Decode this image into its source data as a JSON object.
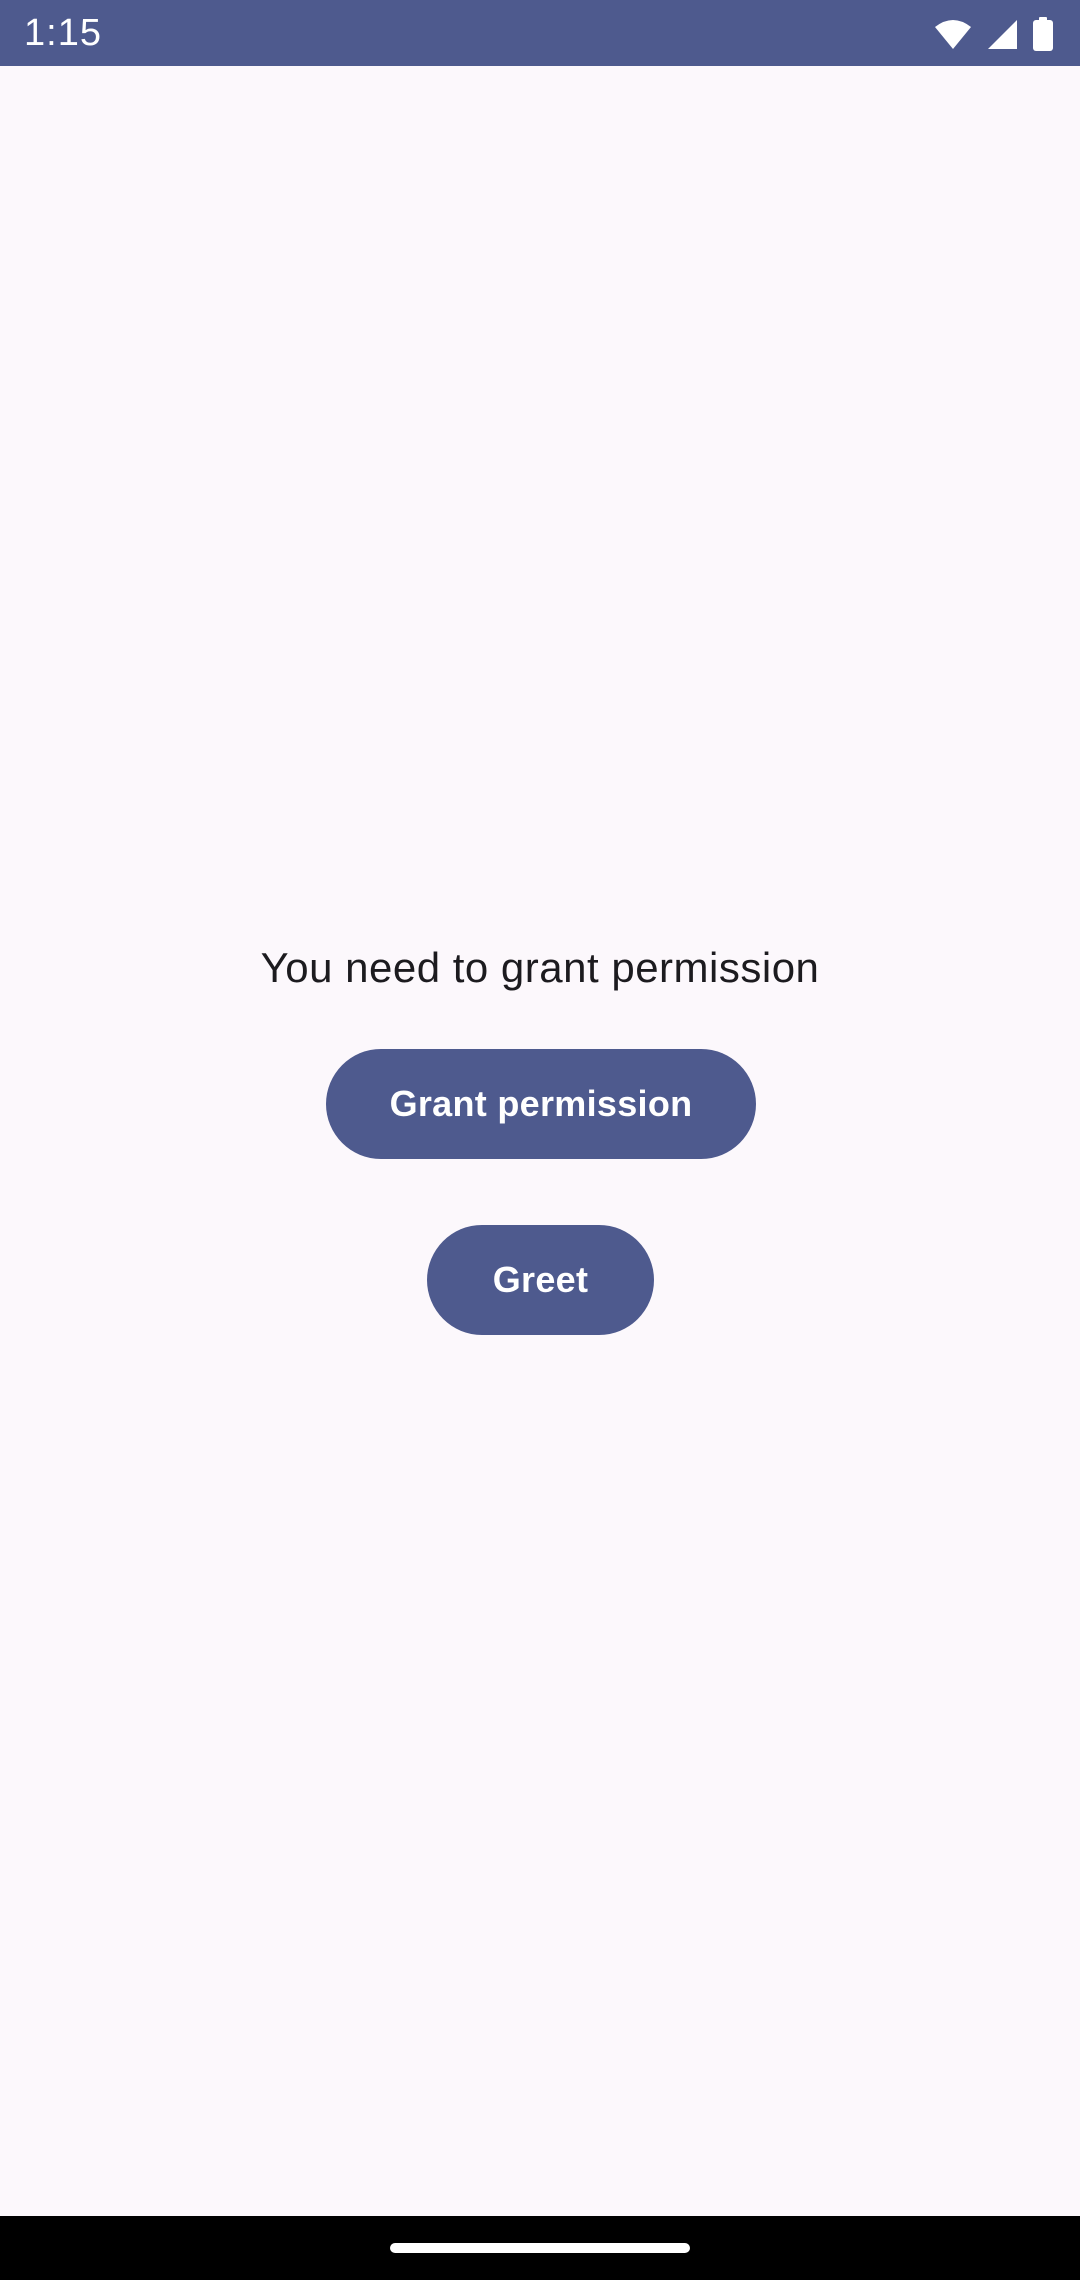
{
  "status_bar": {
    "time": "1:15",
    "icons": [
      "wifi-icon",
      "cellular-signal-icon",
      "battery-icon"
    ]
  },
  "main": {
    "message": "You need to grant permission",
    "grant_button_label": "Grant permission",
    "greet_button_label": "Greet"
  },
  "colors": {
    "primary": "#4e5a8e",
    "background": "#fcf8fc",
    "text": "#1c1b1f",
    "nav_bar": "#000000"
  }
}
